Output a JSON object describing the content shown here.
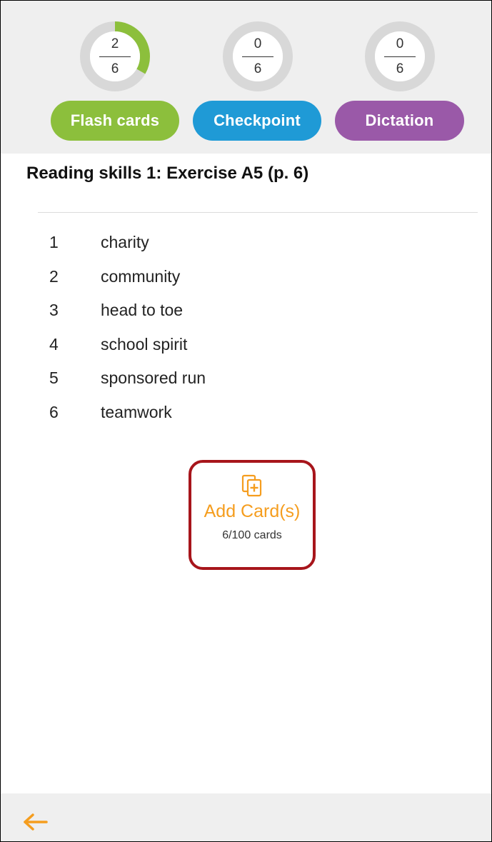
{
  "colors": {
    "flash": "#8cbf3c",
    "checkpoint": "#1f9ad6",
    "dictation": "#9a59a8",
    "accent": "#f59d1e",
    "highlight": "#a7151b"
  },
  "gauges": [
    {
      "numerator": "2",
      "denominator": "6",
      "progress": 0.333
    },
    {
      "numerator": "0",
      "denominator": "6",
      "progress": 0
    },
    {
      "numerator": "0",
      "denominator": "6",
      "progress": 0
    }
  ],
  "modes": {
    "flash_label": "Flash cards",
    "checkpoint_label": "Checkpoint",
    "dictation_label": "Dictation"
  },
  "exercise": {
    "title": "Reading skills 1: Exercise A5 (p. 6)",
    "items": [
      {
        "num": "1",
        "word": "charity"
      },
      {
        "num": "2",
        "word": "community"
      },
      {
        "num": "3",
        "word": "head to toe"
      },
      {
        "num": "4",
        "word": "school spirit"
      },
      {
        "num": "5",
        "word": "sponsored run"
      },
      {
        "num": "6",
        "word": "teamwork"
      }
    ]
  },
  "add_card": {
    "icon": "add-cards-icon",
    "label": "Add Card(s)",
    "count": "6/100 cards"
  },
  "footer": {
    "back_icon": "arrow-left-icon"
  }
}
